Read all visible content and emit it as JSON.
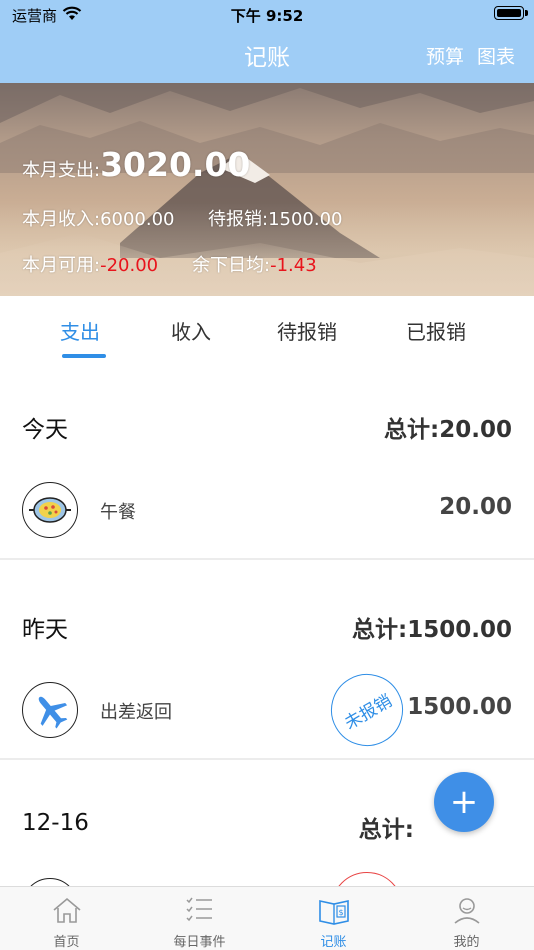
{
  "status": {
    "carrier": "运营商",
    "time": "下午 9:52"
  },
  "nav": {
    "title": "记账",
    "budget": "预算",
    "chart": "图表"
  },
  "summary": {
    "expense_label": "本月支出:",
    "expense_value": "3020.00",
    "income_label": "本月收入:",
    "income_value": "6000.00",
    "pending_label": "待报销:",
    "pending_value": "1500.00",
    "available_label": "本月可用:",
    "available_value": "-20.00",
    "daily_label": "余下日均:",
    "daily_value": "-1.43",
    "negative_color": "#e8141c"
  },
  "tabs": [
    "支出",
    "收入",
    "待报销",
    "已报销"
  ],
  "active_tab": "支出",
  "groups": [
    {
      "date": "今天",
      "total": "总计:20.00",
      "records": [
        {
          "icon": "meal-icon",
          "name": "午餐",
          "amount": "20.00"
        }
      ]
    },
    {
      "date": "昨天",
      "total": "总计:1500.00",
      "records": [
        {
          "icon": "airplane-icon",
          "name": "出差返回",
          "amount": "1500.00",
          "stamp": "未报销"
        }
      ]
    },
    {
      "date": "12-16",
      "total": "总计:"
    }
  ],
  "fab": {
    "label": "+"
  },
  "tabbar": [
    {
      "icon": "home-icon",
      "label": "首页"
    },
    {
      "icon": "checklist-icon",
      "label": "每日事件"
    },
    {
      "icon": "ledger-icon",
      "label": "记账"
    },
    {
      "icon": "user-icon",
      "label": "我的"
    }
  ],
  "accent_color": "#2f8ee6",
  "nav_color": "#9fcdf6"
}
